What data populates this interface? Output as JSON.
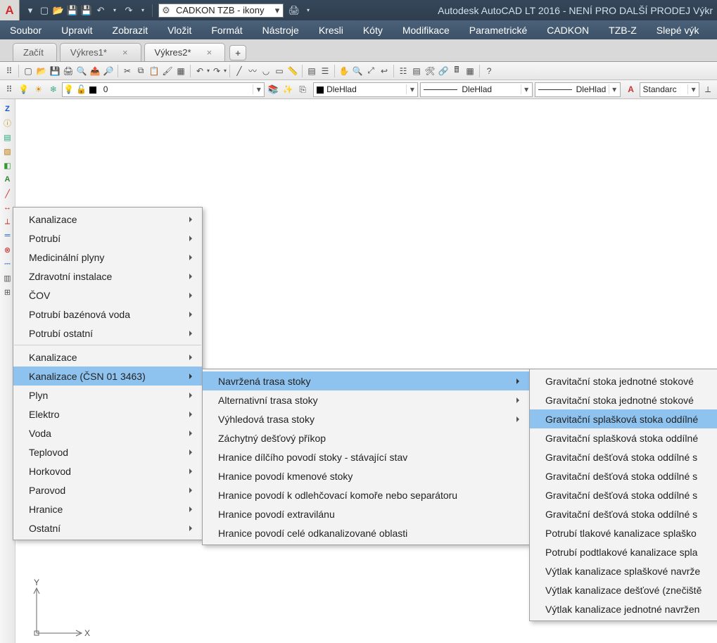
{
  "titlebar": {
    "workspace": "CADKON TZB - ikony",
    "title": "Autodesk AutoCAD LT 2016 - NENÍ PRO DALŠÍ PRODEJ   Výkr"
  },
  "menubar": [
    "Soubor",
    "Upravit",
    "Zobrazit",
    "Vložit",
    "Formát",
    "Nástroje",
    "Kresli",
    "Kóty",
    "Modifikace",
    "Parametrické",
    "CADKON",
    "TZB-Z",
    "Slepé výk"
  ],
  "tabs": [
    {
      "label": "Začít",
      "closable": false,
      "active": false
    },
    {
      "label": "Výkres1*",
      "closable": true,
      "active": false
    },
    {
      "label": "Výkres2*",
      "closable": true,
      "active": true
    }
  ],
  "layer": {
    "value": "0"
  },
  "color": {
    "value": "DleHlad"
  },
  "linetype": {
    "value": "DleHlad"
  },
  "lineweight": {
    "value": "DleHlad"
  },
  "textstyle": {
    "value": "Standarc"
  },
  "context1": {
    "items": [
      {
        "label": "Kanalizace",
        "sub": true
      },
      {
        "label": "Potrubí",
        "sub": true
      },
      {
        "label": "Medicinální plyny",
        "sub": true
      },
      {
        "label": "Zdravotní instalace",
        "sub": true
      },
      {
        "label": "ČOV",
        "sub": true
      },
      {
        "label": "Potrubí bazénová voda",
        "sub": true
      },
      {
        "label": "Potrubí ostatní",
        "sub": true
      },
      {
        "sep": true
      },
      {
        "label": "Kanalizace",
        "sub": true
      },
      {
        "label": "Kanalizace (ČSN 01 3463)",
        "sub": true,
        "selected": true
      },
      {
        "label": "Plyn",
        "sub": true
      },
      {
        "label": "Elektro",
        "sub": true
      },
      {
        "label": "Voda",
        "sub": true
      },
      {
        "label": "Teplovod",
        "sub": true
      },
      {
        "label": "Horkovod",
        "sub": true
      },
      {
        "label": "Parovod",
        "sub": true
      },
      {
        "label": "Hranice",
        "sub": true
      },
      {
        "label": "Ostatní",
        "sub": true
      }
    ]
  },
  "context2": {
    "items": [
      {
        "label": "Navržená trasa stoky",
        "sub": true,
        "selected": true
      },
      {
        "label": "Alternativní trasa stoky",
        "sub": true
      },
      {
        "label": "Výhledová trasa stoky",
        "sub": true
      },
      {
        "label": "Záchytný dešťový příkop"
      },
      {
        "label": "Hranice dílčího povodí stoky - stávající stav"
      },
      {
        "label": "Hranice povodí kmenové stoky"
      },
      {
        "label": "Hranice povodí k odlehčovací komoře nebo separátoru"
      },
      {
        "label": "Hranice povodí extravilánu"
      },
      {
        "label": "Hranice povodí celé odkanalizované oblasti"
      }
    ]
  },
  "context3": {
    "items": [
      {
        "label": "Gravitační stoka jednotné stokové"
      },
      {
        "label": "Gravitační stoka jednotné stokové"
      },
      {
        "label": "Gravitační splašková stoka oddílné",
        "selected": true
      },
      {
        "label": "Gravitační splašková stoka oddílné"
      },
      {
        "label": "Gravitační dešťová stoka oddílné s"
      },
      {
        "label": "Gravitační dešťová stoka oddílné s"
      },
      {
        "label": "Gravitační dešťová stoka oddílné s"
      },
      {
        "label": "Gravitační dešťová stoka oddílné s"
      },
      {
        "label": "Potrubí tlakové kanalizace splaško"
      },
      {
        "label": "Potrubí podtlakové kanalizace spla"
      },
      {
        "label": "Výtlak kanalizace splaškové navrže"
      },
      {
        "label": "Výtlak kanalizace dešťové (znečiště"
      },
      {
        "label": "Výtlak kanalizace jednotné navržen"
      }
    ]
  },
  "ucs": {
    "x": "X",
    "y": "Y"
  }
}
